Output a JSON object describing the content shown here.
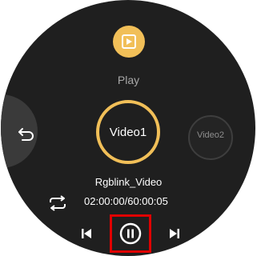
{
  "colors": {
    "accent": "#f1bf58",
    "face": "#1f1f1f",
    "highlight_box": "#e00000"
  },
  "mode": {
    "label": "Play",
    "icon": "play-square-icon"
  },
  "videos": {
    "current": "Video1",
    "next": "Video2"
  },
  "player": {
    "name": "Rgblink_Video",
    "time": "02:00:00/60:00:05"
  },
  "controls": {
    "back_icon": "back-arrow-icon",
    "repeat_icon": "repeat-icon",
    "prev_icon": "skip-previous-icon",
    "pause_icon": "pause-circle-icon",
    "next_icon": "skip-next-icon"
  }
}
